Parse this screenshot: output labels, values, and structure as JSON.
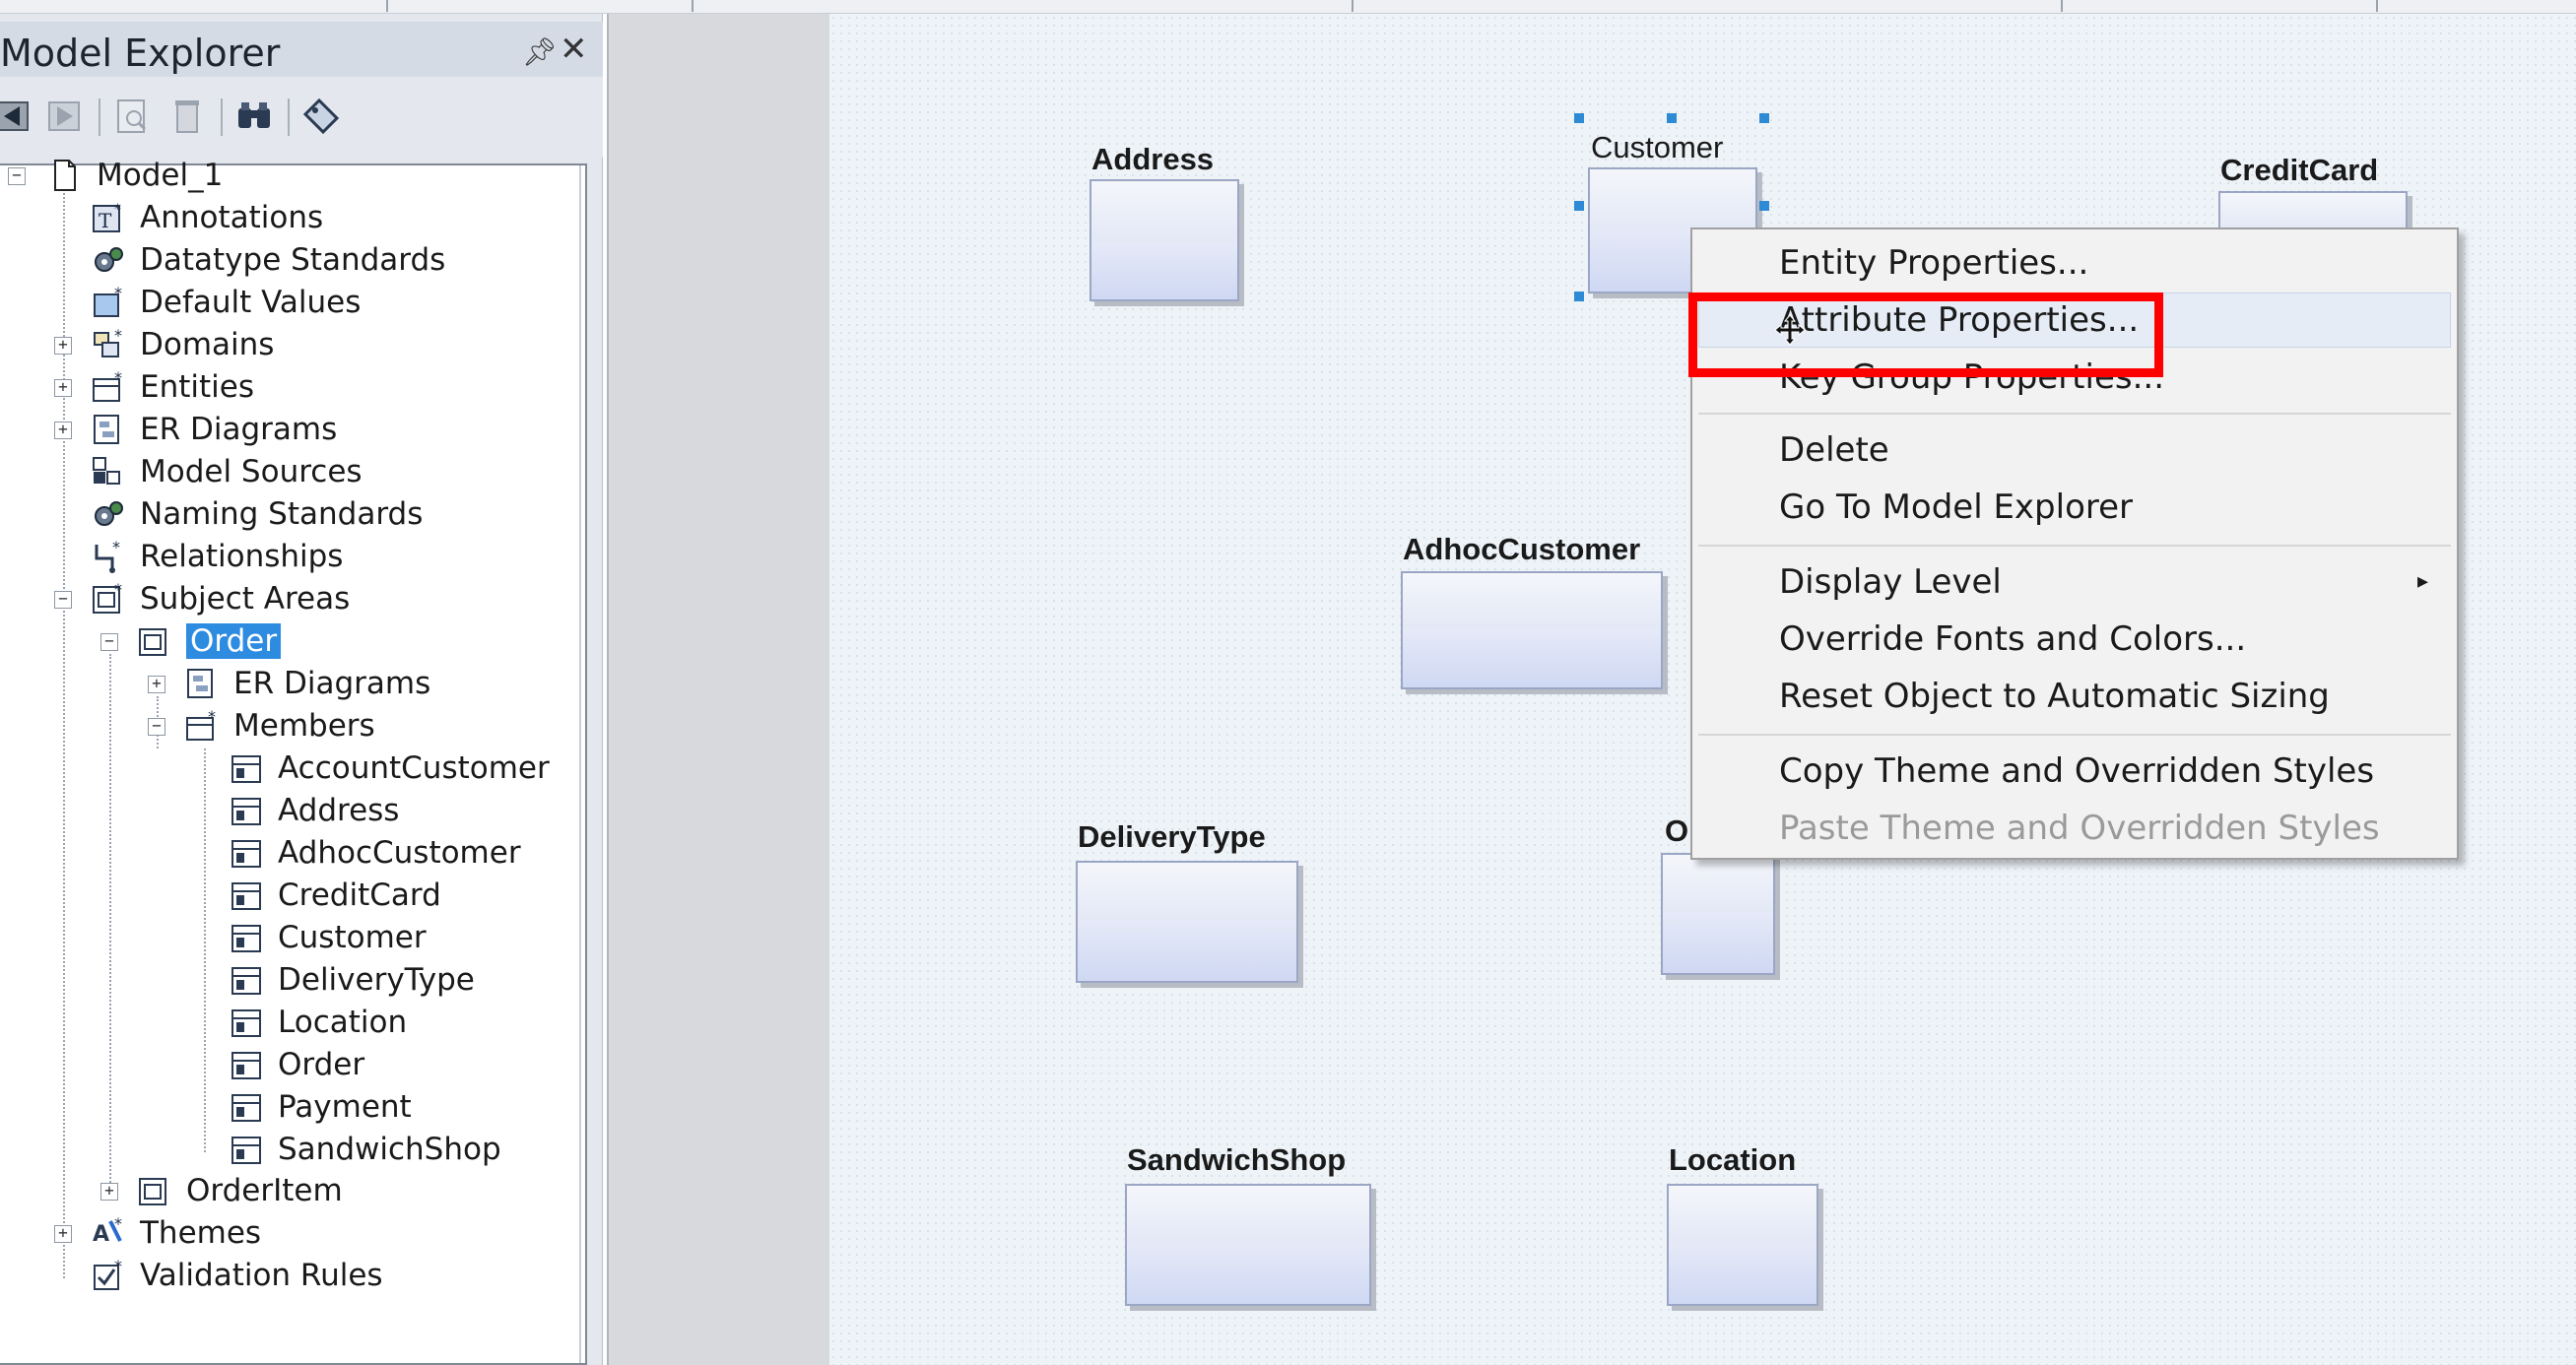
{
  "explorer": {
    "title": "Model Explorer",
    "pin_icon": "pin-icon",
    "close_icon": "close-icon",
    "toolbar": [
      "back-icon",
      "forward-icon",
      "properties-icon",
      "delete-icon",
      "binoculars-icon",
      "tag-icon"
    ]
  },
  "tree": {
    "model": "Model_1",
    "annotations": "Annotations",
    "datatype_standards": "Datatype Standards",
    "default_values": "Default Values",
    "domains": "Domains",
    "entities": "Entities",
    "er_diagrams": "ER Diagrams",
    "model_sources": "Model Sources",
    "naming_standards": "Naming Standards",
    "relationships": "Relationships",
    "subject_areas": "Subject Areas",
    "order": "Order",
    "order_er_diagrams": "ER Diagrams",
    "members": "Members",
    "member_items": [
      "AccountCustomer",
      "Address",
      "AdhocCustomer",
      "CreditCard",
      "Customer",
      "DeliveryType",
      "Location",
      "Order",
      "Payment",
      "SandwichShop"
    ],
    "orderitem": "OrderItem",
    "themes": "Themes",
    "validation_rules": "Validation Rules"
  },
  "entities": {
    "address": "Address",
    "customer": "Customer",
    "creditcard": "CreditCard",
    "adhoccustomer": "AdhocCustomer",
    "deliverytype": "DeliveryType",
    "order_partial": "O",
    "sandwichshop": "SandwichShop",
    "location": "Location"
  },
  "context_menu": {
    "entity_properties": "Entity Properties...",
    "attribute_properties": "Attribute Properties...",
    "key_group_properties": "Key Group Properties...",
    "delete": "Delete",
    "go_to_model_explorer": "Go To Model Explorer",
    "display_level": "Display Level",
    "override_fonts": "Override Fonts and Colors...",
    "reset_sizing": "Reset Object to Automatic Sizing",
    "copy_theme": "Copy Theme and Overridden Styles",
    "paste_theme": "Paste Theme and Overridden Styles",
    "submenu_arrow": "▸"
  },
  "colors": {
    "highlight": "#ff0000",
    "selection": "#2d8be0",
    "entity_fill": "#dfe5f5"
  }
}
